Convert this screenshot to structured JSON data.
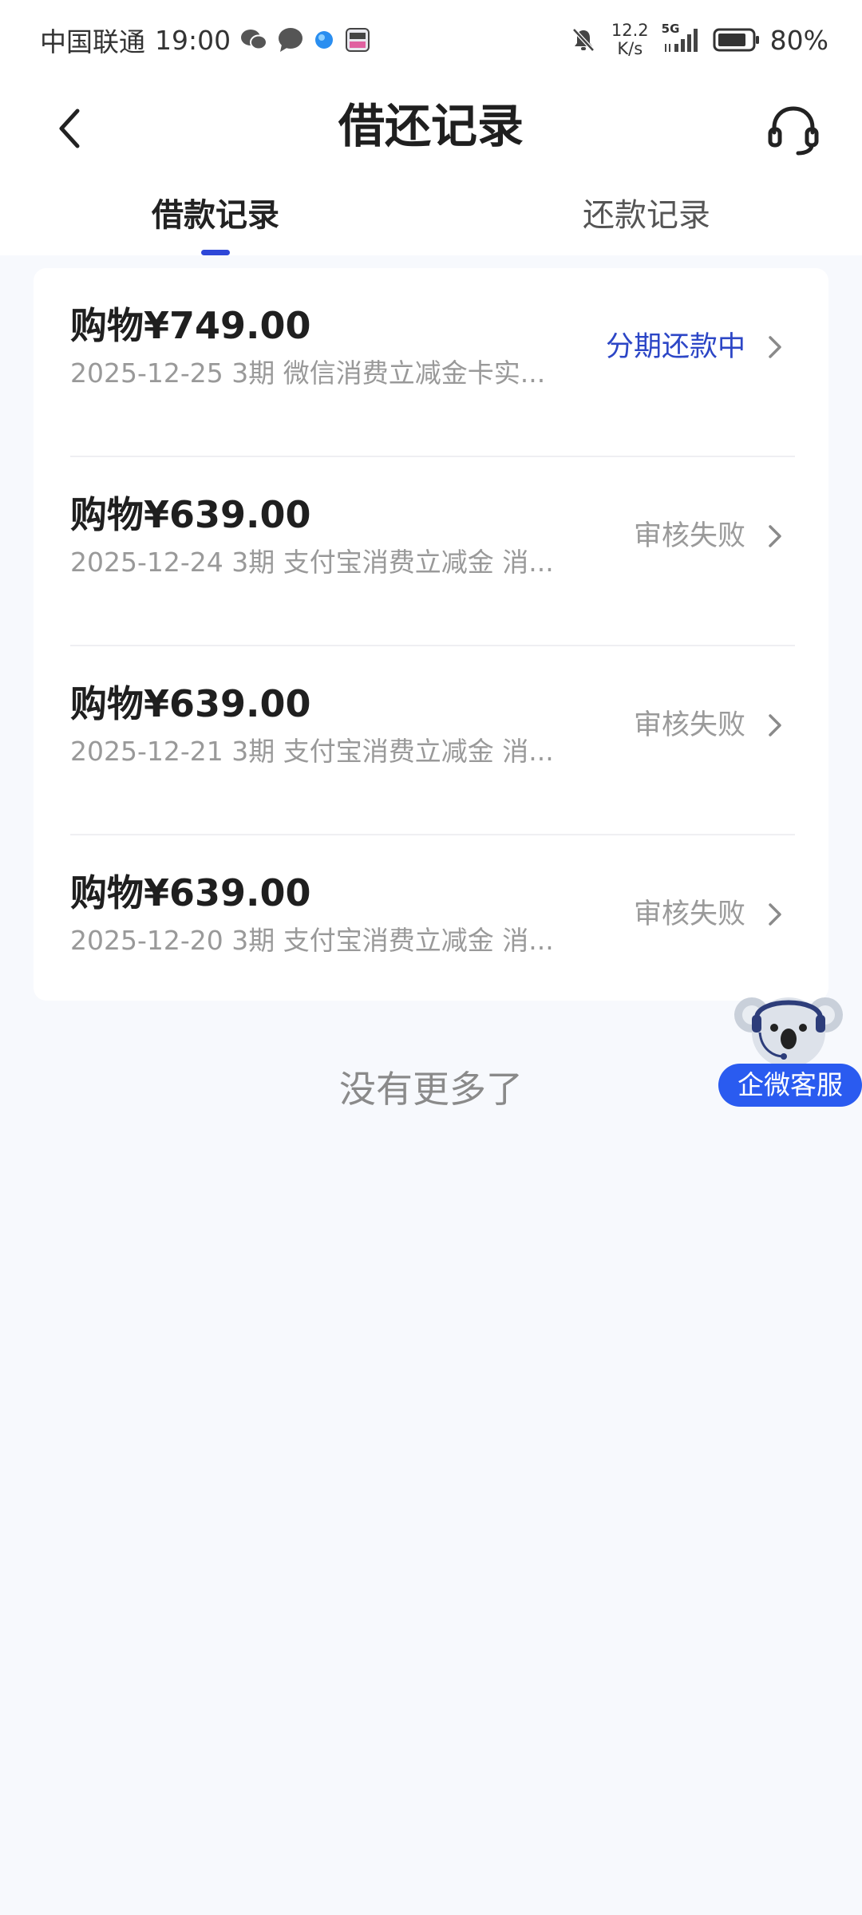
{
  "status_bar": {
    "carrier": "中国联通",
    "time": "19:00",
    "net_speed_value": "12.2",
    "net_speed_unit": "K/s",
    "signal_label": "5G",
    "battery": "80%"
  },
  "header": {
    "title": "借还记录"
  },
  "tabs": [
    {
      "label": "借款记录",
      "active": true
    },
    {
      "label": "还款记录",
      "active": false
    }
  ],
  "records": [
    {
      "amount": "购物¥749.00",
      "detail": "2025-12-25 3期  微信消费立减金卡实...",
      "status": "分期还款中",
      "status_color": "#2c46c6"
    },
    {
      "amount": "购物¥639.00",
      "detail": "2025-12-24 3期  支付宝消费立减金 消...",
      "status": "审核失败",
      "status_color": "#9a9a9a"
    },
    {
      "amount": "购物¥639.00",
      "detail": "2025-12-21 3期  支付宝消费立减金 消...",
      "status": "审核失败",
      "status_color": "#9a9a9a"
    },
    {
      "amount": "购物¥639.00",
      "detail": "2025-12-20 3期  支付宝消费立减金 消...",
      "status": "审核失败",
      "status_color": "#9a9a9a"
    }
  ],
  "footer_text": "没有更多了",
  "floating_service": {
    "label": "企微客服"
  },
  "colors": {
    "accent": "#2e47d8",
    "background": "#f7f9fd",
    "float_button": "#2a5bf0"
  }
}
